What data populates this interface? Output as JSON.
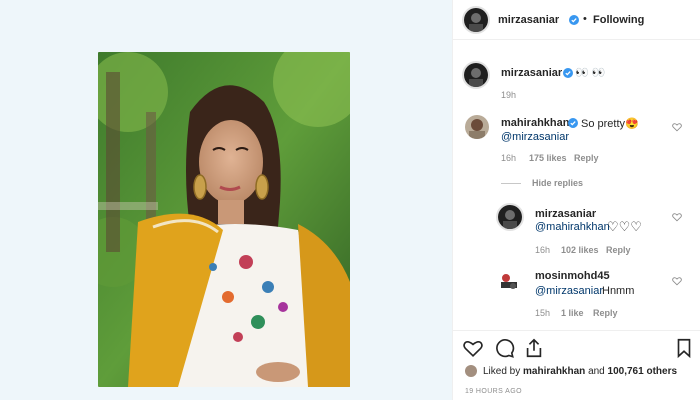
{
  "post": {
    "photo_alt": "",
    "author": "mirzasaniar",
    "follow_status": "Following",
    "separator": "•",
    "caption_username": "mirzasaniar",
    "caption_text": "👀 👀",
    "caption_time": "19h",
    "likes_prefix": "Liked by",
    "likes_user": "mahirahkhan",
    "likes_and": "and",
    "likes_others": "100,761 others",
    "time_ago": "19 HOURS AGO"
  },
  "comments": [
    {
      "username": "mahirahkhan",
      "text": "So pretty😍",
      "mention": "@mirzasaniar",
      "time": "16h",
      "likes": "175 likes",
      "reply": "Reply"
    }
  ],
  "hide_replies": "Hide replies",
  "replies": [
    {
      "username": "mirzasaniar",
      "mention": "@mahirahkhan",
      "hearts": "♡♡♡",
      "time": "16h",
      "likes": "102 likes",
      "reply": "Reply"
    },
    {
      "username": "mosinmohd45",
      "mention": "@mirzasaniar",
      "text": "Hnmm",
      "time": "15h",
      "likes": "1 like",
      "reply": "Reply"
    }
  ],
  "colors": {
    "verified": "#3897f0",
    "mention": "#00376b",
    "muted": "#8e8e8e",
    "dupatta": "#e0a31c"
  },
  "icons": [
    "heart-icon",
    "comment-icon",
    "share-icon",
    "bookmark-icon",
    "verified-badge-icon"
  ]
}
